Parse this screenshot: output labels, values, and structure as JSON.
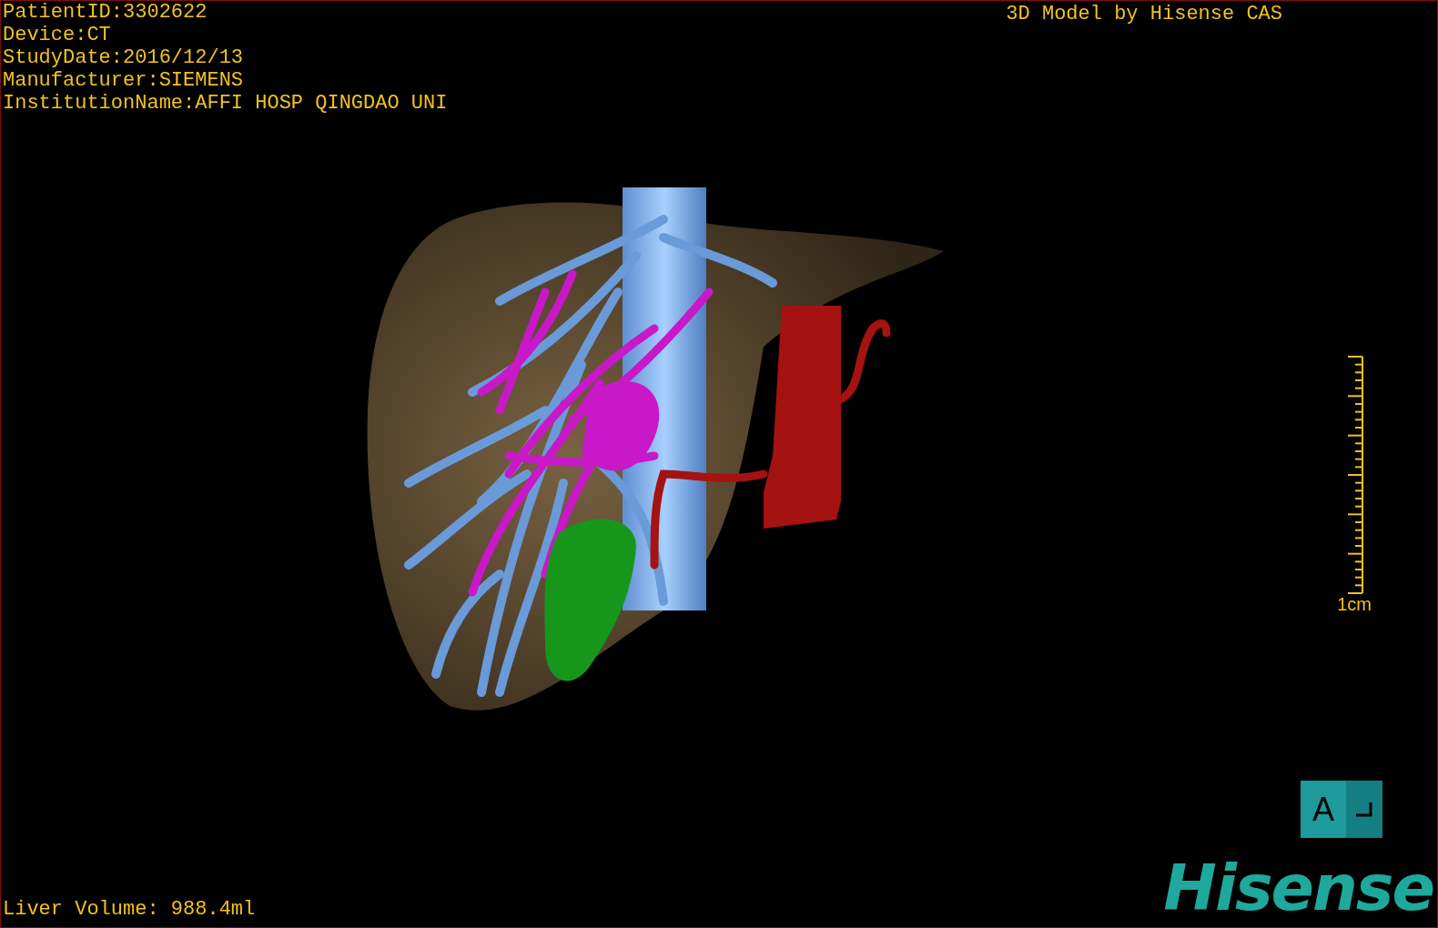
{
  "patient_info": [
    "PatientID:3302622",
    "Device:CT",
    "StudyDate:2016/12/13",
    "Manufacturer:SIEMENS",
    "InstitutionName:AFFI HOSP QINGDAO UNI"
  ],
  "header_right": "3D Model by Hisense CAS",
  "scale": {
    "label": "1cm"
  },
  "orientation_cube": {
    "front_label": "A"
  },
  "liver_volume": "Liver Volume: 988.4ml",
  "logo": "Hisense"
}
